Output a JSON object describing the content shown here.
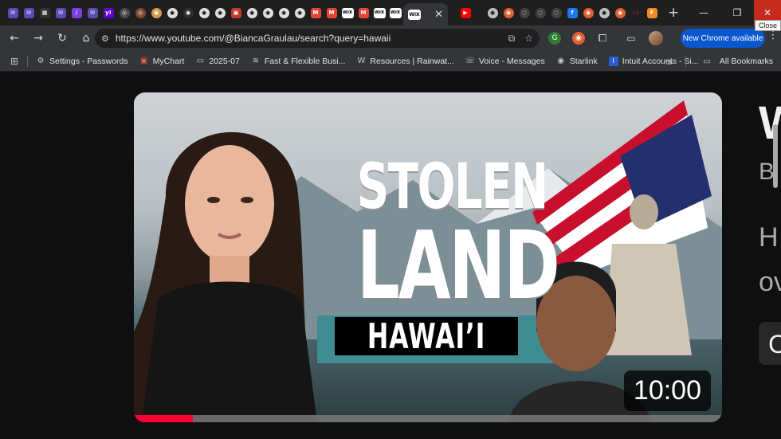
{
  "browser": {
    "tab_favicons": [
      {
        "name": "mail",
        "color": "#5f4bb6",
        "glyph": "✉"
      },
      {
        "name": "mail",
        "color": "#5f4bb6",
        "glyph": "✉"
      },
      {
        "name": "grid",
        "color": "#333333",
        "glyph": "▦"
      },
      {
        "name": "mail",
        "color": "#5f4bb6",
        "glyph": "✉"
      },
      {
        "name": "slash",
        "color": "#7b3fe4",
        "glyph": "/"
      },
      {
        "name": "mail",
        "color": "#5f4bb6",
        "glyph": "✉"
      },
      {
        "name": "yahoo",
        "color": "#6001d2",
        "glyph": "y!"
      },
      {
        "name": "round",
        "color": "#4a4a4a",
        "glyph": "◎"
      },
      {
        "name": "round",
        "color": "#7a4a30",
        "glyph": "◎"
      },
      {
        "name": "round",
        "color": "#d0a050",
        "glyph": "◉"
      },
      {
        "name": "round",
        "color": "#e0e0e0",
        "glyph": "◉"
      },
      {
        "name": "round",
        "color": "#303030",
        "glyph": "◉"
      },
      {
        "name": "round",
        "color": "#e0e0e0",
        "glyph": "◉"
      },
      {
        "name": "round",
        "color": "#e0e0e0",
        "glyph": "◉"
      },
      {
        "name": "red",
        "color": "#c0392b",
        "glyph": "▣"
      },
      {
        "name": "round",
        "color": "#e0e0e0",
        "glyph": "◉"
      },
      {
        "name": "round",
        "color": "#e0e0e0",
        "glyph": "◉"
      },
      {
        "name": "round",
        "color": "#e0e0e0",
        "glyph": "◉"
      },
      {
        "name": "round",
        "color": "#e0e0e0",
        "glyph": "◉"
      },
      {
        "name": "gmail",
        "color": "#ea4335",
        "glyph": "M"
      },
      {
        "name": "gmail",
        "color": "#ea4335",
        "glyph": "M"
      },
      {
        "name": "wix",
        "color": "#ffffff",
        "glyph": "WiX"
      },
      {
        "name": "gmail",
        "color": "#ea4335",
        "glyph": "M"
      },
      {
        "name": "wix",
        "color": "#ffffff",
        "glyph": "WiX"
      },
      {
        "name": "wix",
        "color": "#ffffff",
        "glyph": "WiX"
      }
    ],
    "active_tab_favicon": "WiX",
    "tab_favicons_right": [
      {
        "name": "youtube",
        "color": "#ff0000",
        "glyph": "▶"
      },
      {
        "name": "round",
        "color": "#c0c0c0",
        "glyph": "◉"
      },
      {
        "name": "round",
        "color": "#e06030",
        "glyph": "◉"
      },
      {
        "name": "round",
        "color": "#404040",
        "glyph": "◌"
      },
      {
        "name": "round",
        "color": "#404040",
        "glyph": "◌"
      },
      {
        "name": "round",
        "color": "#404040",
        "glyph": "◌"
      },
      {
        "name": "facebook",
        "color": "#1877f2",
        "glyph": "f"
      },
      {
        "name": "round",
        "color": "#e06030",
        "glyph": "◉"
      },
      {
        "name": "round",
        "color": "#c0c0c0",
        "glyph": "◉"
      },
      {
        "name": "round",
        "color": "#e06030",
        "glyph": "◉"
      },
      {
        "name": "lii",
        "color": "#8b1a1a",
        "glyph": "LII"
      },
      {
        "name": "f-orange",
        "color": "#f08a24",
        "glyph": "F"
      }
    ],
    "window_close_tooltip": "Close",
    "url": "https://www.youtube.com/@BiancaGraulau/search?query=hawaii",
    "update_button": "New Chrome available",
    "bookmarks": [
      {
        "icon": "gear-icon",
        "glyph": "⚙",
        "label": "Settings - Passwords"
      },
      {
        "icon": "mychart-icon",
        "glyph": "▣",
        "label": "MyChart"
      },
      {
        "icon": "folder-icon",
        "glyph": "▭",
        "label": "2025-07"
      },
      {
        "icon": "wifi-icon",
        "glyph": "≋",
        "label": "Fast & Flexible Busi..."
      },
      {
        "icon": "w-icon",
        "glyph": "W",
        "label": "Resources | Rainwat..."
      },
      {
        "icon": "voice-icon",
        "glyph": "☏",
        "label": "Voice - Messages"
      },
      {
        "icon": "starlink-icon",
        "glyph": "◉",
        "label": "Starlink"
      },
      {
        "icon": "intuit-icon",
        "glyph": "I",
        "label": "Intuit Accounts - Si..."
      }
    ],
    "all_bookmarks": "All Bookmarks",
    "overflow_glyph": "»"
  },
  "video": {
    "thumbnail_text": {
      "line1": "STOLEN",
      "line2": "LAND",
      "line3": "HAWAI’I"
    },
    "duration": "10:00",
    "watched_fraction": 0.1,
    "accent": "#ff0033"
  },
  "meta_cutoff": {
    "title": "W",
    "channel": "B",
    "desc1": "H",
    "desc2": "ov",
    "chip": "C"
  }
}
